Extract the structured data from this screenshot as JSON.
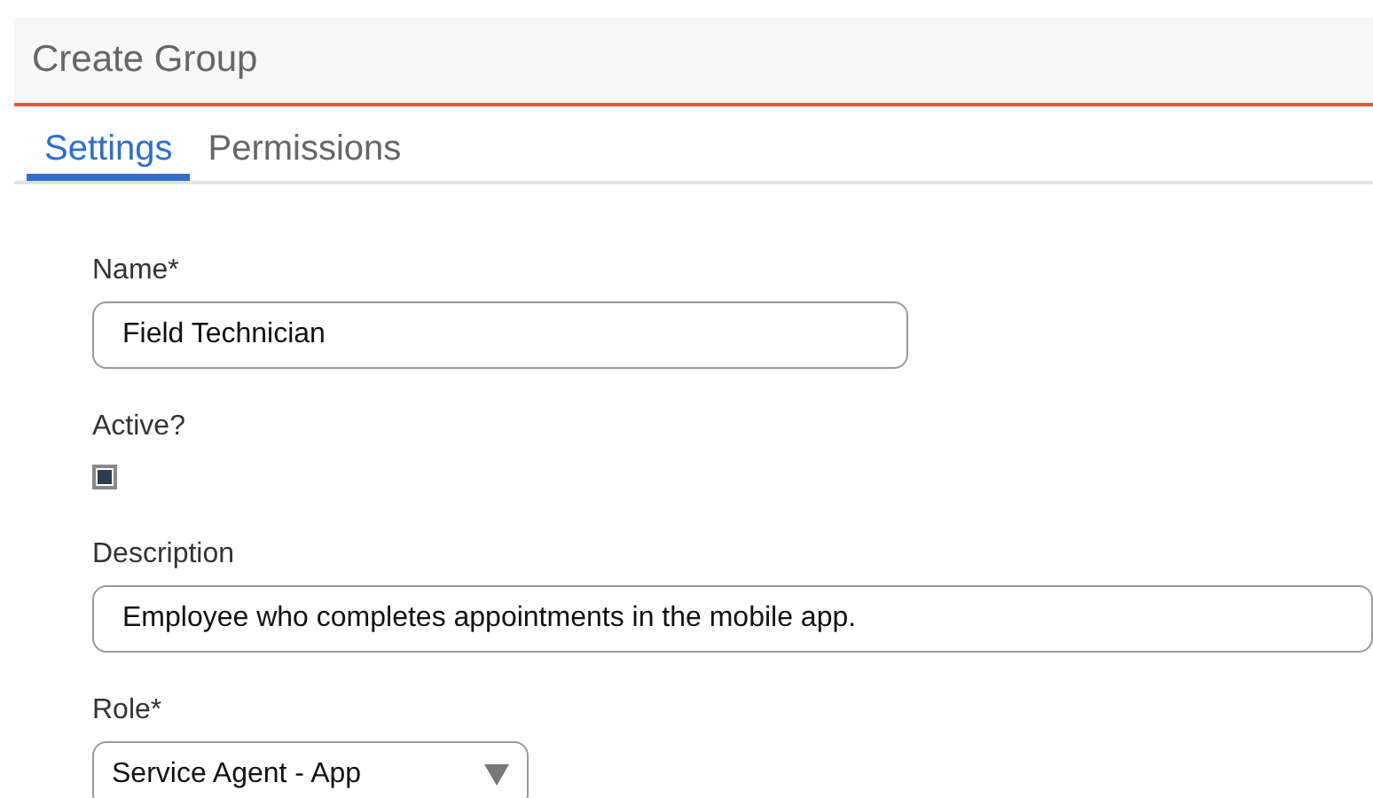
{
  "header": {
    "title": "Create Group"
  },
  "tabs": [
    {
      "label": "Settings",
      "selected": true
    },
    {
      "label": "Permissions",
      "selected": false
    }
  ],
  "form": {
    "name": {
      "label": "Name*",
      "value": "Field Technician"
    },
    "active": {
      "label": "Active?",
      "checked": true
    },
    "description": {
      "label": "Description",
      "value": "Employee who completes appointments in the mobile app."
    },
    "role": {
      "label": "Role*",
      "value": "Service Agent - App"
    }
  }
}
